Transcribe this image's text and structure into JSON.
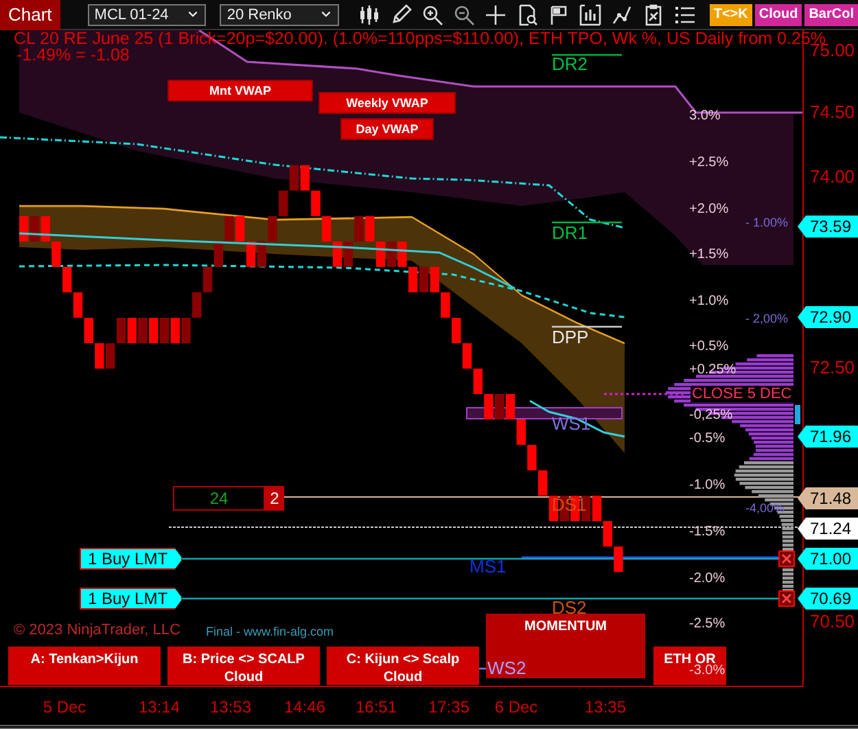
{
  "toolbar": {
    "title": "Chart",
    "instrument": "MCL 01-24",
    "bar_type": "20 Renko",
    "toggles": [
      {
        "label": "T<>K",
        "color": "#f0a000"
      },
      {
        "label": "Cloud",
        "color": "#d0289a"
      },
      {
        "label": "BarCol",
        "color": "#d0289a"
      }
    ]
  },
  "chart": {
    "info": [
      "CL 20 RE June 25 (1 Brick=20p=$20.00). (1.0%=110pps=$110.00), ETH TPO, Wk %, US Daily from 0.25%",
      "-1.49% = -1.08"
    ],
    "vwap_labels": [
      "Mnt VWAP",
      "Weekly VWAP",
      "Day VWAP"
    ],
    "pivot_labels": [
      {
        "label": "DR2",
        "color": "#00c040"
      },
      {
        "label": "DR1",
        "color": "#00c040"
      },
      {
        "label": "DPP",
        "color": "#e8e8e8"
      },
      {
        "label": "WS1",
        "color": "#8070e0"
      },
      {
        "label": "DS1",
        "color": "#d05010"
      },
      {
        "label": "MS1",
        "color": "#1030e0"
      },
      {
        "label": "DS2",
        "color": "#d05010"
      },
      {
        "label": "WS2",
        "color": "#a8a0ff"
      }
    ],
    "percent_labels": [
      "3.0%",
      "+2.5%",
      "+2.0%",
      "+1.5%",
      "+1.0%",
      "+0.5%",
      "+0.25%",
      "-0,25%",
      "-0.5%",
      "-1.0%",
      "-1.5%",
      "-2.0%",
      "-2.5%",
      "-3.0%"
    ],
    "close_label": "CLOSE 5 DEC",
    "deviation_labels": [
      "- 1.00%",
      "- 2,00%",
      "-4,00%"
    ],
    "price_ticks": [
      "75.00",
      "74.50",
      "74.00",
      "72.50",
      "70.50"
    ],
    "price_tags": [
      {
        "value": "73.59",
        "color": "#00ffff"
      },
      {
        "value": "72.90",
        "color": "#00ffff"
      },
      {
        "value": "71.96",
        "color": "#00ffff"
      },
      {
        "value": "71.48",
        "color": "#d8b898"
      },
      {
        "value": "71.24",
        "color": "#ffffff"
      },
      {
        "value": "71.00",
        "color": "#00ffff"
      },
      {
        "value": "70.69",
        "color": "#00ffff"
      }
    ],
    "orders": [
      {
        "label": "1 Buy LMT"
      },
      {
        "label": "1 Buy LMT"
      }
    ],
    "position": {
      "value": "24",
      "quantity": "2"
    },
    "signals": [
      "A: Tenkan>Kijun",
      "B: Price <> SCALP Cloud",
      "C: Kijun <> Scalp Cloud",
      "MOMENTUM",
      "ETH OR"
    ],
    "copyright": "© 2023 NinjaTrader, LLC",
    "credit": "Final - www.fin-alg.com",
    "time_labels": [
      "5 Dec",
      "13:14",
      "13:53",
      "14:46",
      "16:51",
      "17:35",
      "6 Dec",
      "13:35"
    ]
  }
}
